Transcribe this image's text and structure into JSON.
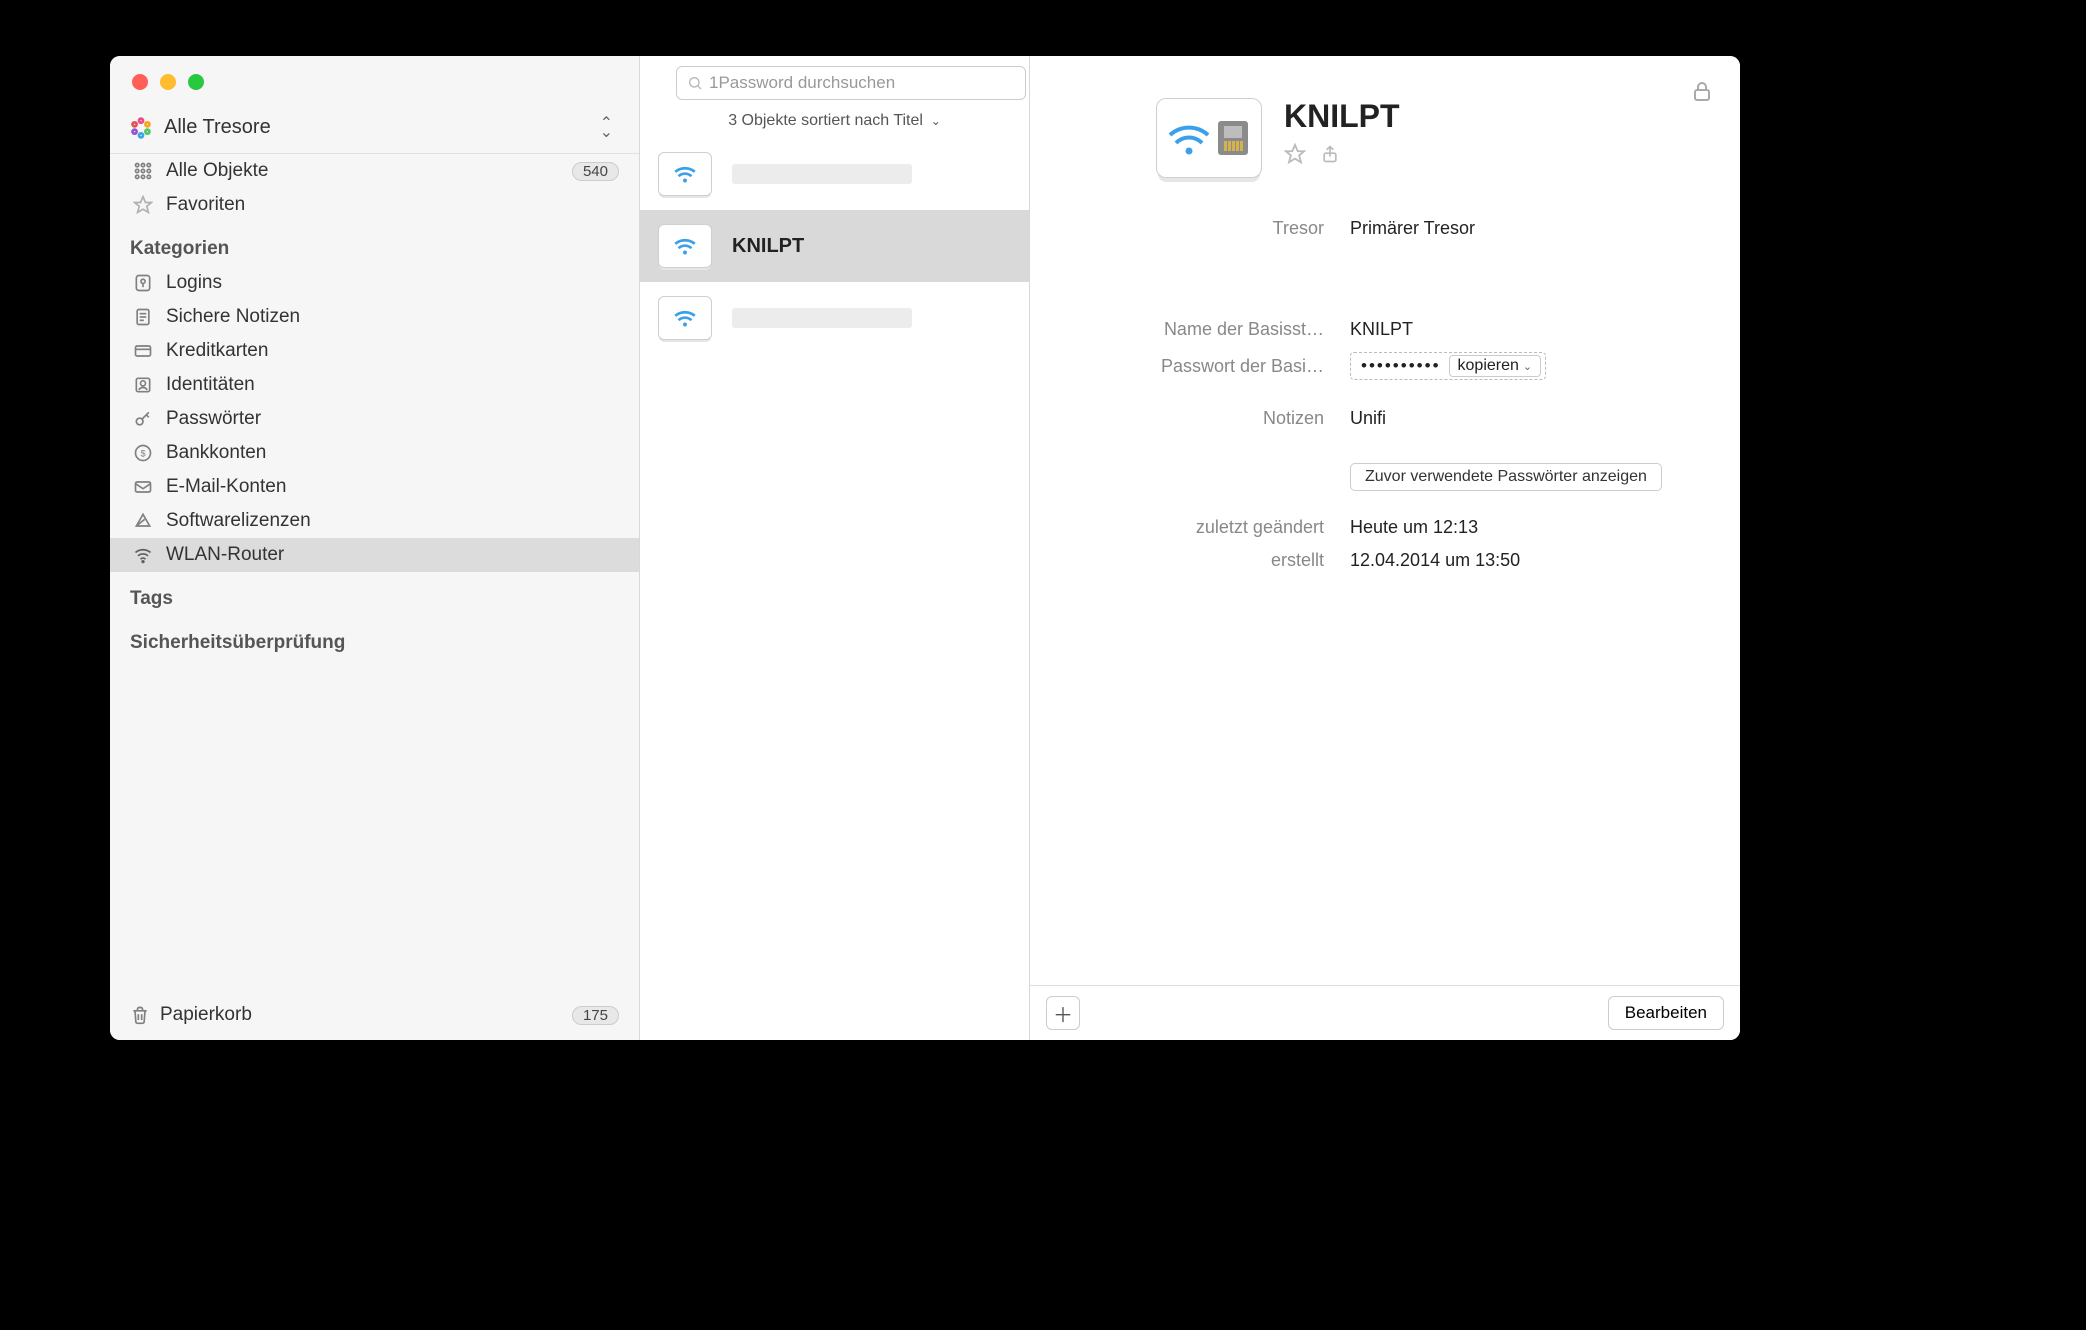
{
  "vaultSelector": "Alle Tresore",
  "search": {
    "placeholder": "1Password durchsuchen"
  },
  "sort": "3 Objekte sortiert nach Titel",
  "sidebar": {
    "allItems": {
      "label": "Alle Objekte",
      "count": "540"
    },
    "favorites": "Favoriten",
    "sectionCategories": "Kategorien",
    "cats": {
      "logins": "Logins",
      "secureNotes": "Sichere Notizen",
      "creditCards": "Kreditkarten",
      "identities": "Identitäten",
      "passwords": "Passwörter",
      "bankAccounts": "Bankkonten",
      "emailAccounts": "E-Mail-Konten",
      "softwareLicenses": "Softwarelizenzen",
      "wifiRouters": "WLAN-Router"
    },
    "sectionTags": "Tags",
    "sectionSecurity": "Sicherheitsüberprüfung",
    "trash": {
      "label": "Papierkorb",
      "count": "175"
    }
  },
  "items": {
    "row1": "",
    "row2": "KNILPT",
    "row3": ""
  },
  "detail": {
    "title": "KNILPT",
    "vaultLabel": "Tresor",
    "vaultValue": "Primärer Tresor",
    "baseNameLabel": "Name der Basisst…",
    "baseNameValue": "KNILPT",
    "basePwLabel": "Passwort der Basi…",
    "basePwDots": "••••••••••",
    "copyLabel": "kopieren",
    "notesLabel": "Notizen",
    "notesValue": "Unifi",
    "prevPwBtn": "Zuvor verwendete Passwörter anzeigen",
    "modifiedLabel": "zuletzt geändert",
    "modifiedValue": "Heute um 12:13",
    "createdLabel": "erstellt",
    "createdValue": "12.04.2014 um 13:50",
    "editBtn": "Bearbeiten"
  }
}
